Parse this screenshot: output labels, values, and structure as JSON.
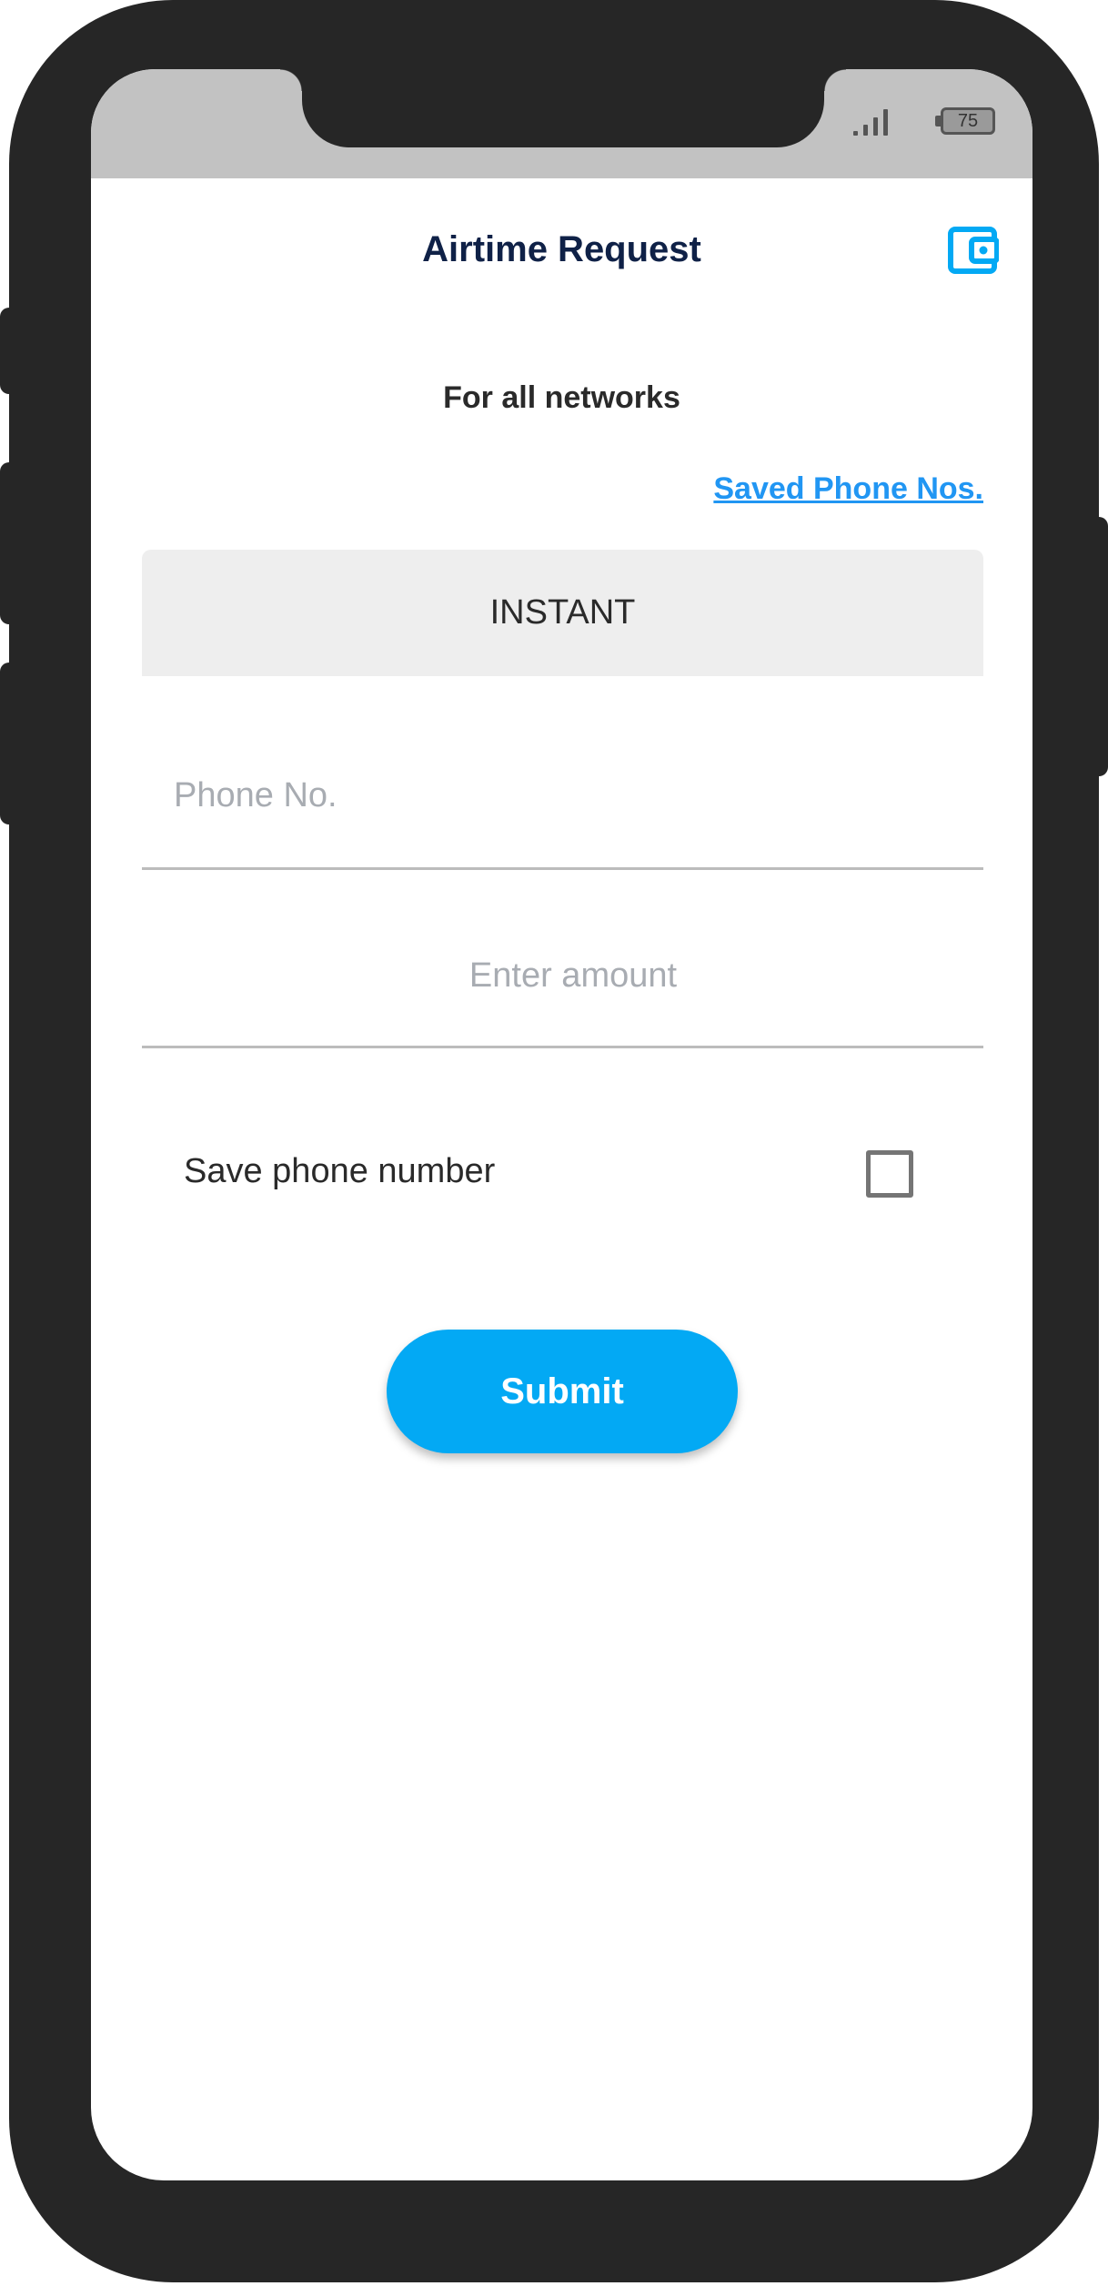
{
  "status_bar": {
    "battery_level": "75",
    "signal_icon": "signal-bars-icon",
    "battery_icon": "battery-icon"
  },
  "header": {
    "title": "Airtime Request",
    "wallet_icon": "wallet-icon"
  },
  "subtitle": "For all networks",
  "saved_link": "Saved Phone Nos.",
  "type_select": {
    "value": "INSTANT"
  },
  "phone_input": {
    "placeholder": "Phone No.",
    "value": ""
  },
  "amount_input": {
    "placeholder": "Enter amount",
    "value": ""
  },
  "save_option": {
    "label": "Save phone number",
    "checked": false
  },
  "submit_label": "Submit",
  "colors": {
    "accent": "#03a9f4",
    "link": "#2196f3",
    "title": "#0f2147",
    "frame": "#262626",
    "status_bar": "#c2c2c2"
  }
}
